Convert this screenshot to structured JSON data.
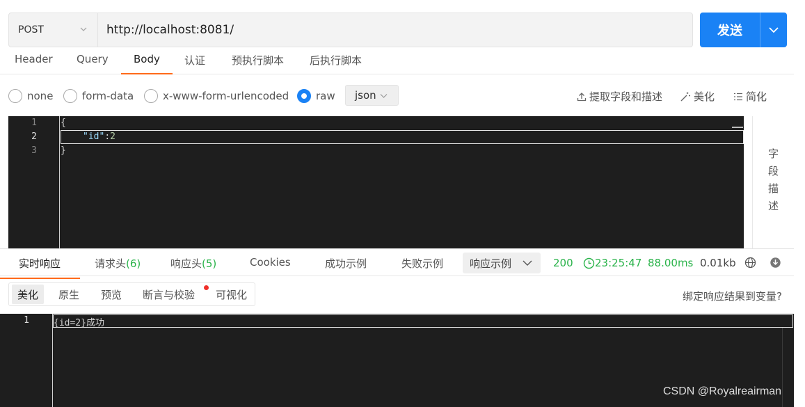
{
  "request": {
    "method": "POST",
    "url": "http://localhost:8081/",
    "send_label": "发送"
  },
  "req_tabs": [
    "Header",
    "Query",
    "Body",
    "认证",
    "预执行脚本",
    "后执行脚本"
  ],
  "body_options": {
    "radios": [
      "none",
      "form-data",
      "x-www-form-urlencoded",
      "raw"
    ],
    "selected": "raw",
    "format": "json",
    "tools": [
      "提取字段和描述",
      "美化",
      "简化"
    ]
  },
  "editor": {
    "line_numbers": [
      "1",
      "2",
      "3"
    ],
    "line1": "{",
    "line2_key": "\"id\"",
    "line2_colon": ":",
    "line2_value": "2",
    "line3": "}"
  },
  "field_desc": [
    "字",
    "段",
    "描",
    "述"
  ],
  "resp_tabs": {
    "realtime": "实时响应",
    "req_headers": "请求头",
    "req_headers_count": "(6)",
    "resp_headers": "响应头",
    "resp_headers_count": "(5)",
    "cookies": "Cookies",
    "success_example": "成功示例",
    "fail_example": "失败示例",
    "example_select": "响应示例"
  },
  "status": {
    "code": "200",
    "time": "23:25:47",
    "duration": "88.00ms",
    "size": "0.01kb"
  },
  "view_tabs": [
    "美化",
    "原生",
    "预览",
    "断言与校验",
    "可视化"
  ],
  "bind_var": "绑定响应结果到变量?",
  "response": {
    "line_number": "1",
    "text": "{id=2}成功"
  },
  "watermark": "CSDN @Royalreairman",
  "colors": {
    "accent": "#1a82f5",
    "tab_underline": "#ff6a1a",
    "success": "#2ab34a",
    "notice_dot": "#f0302a"
  }
}
